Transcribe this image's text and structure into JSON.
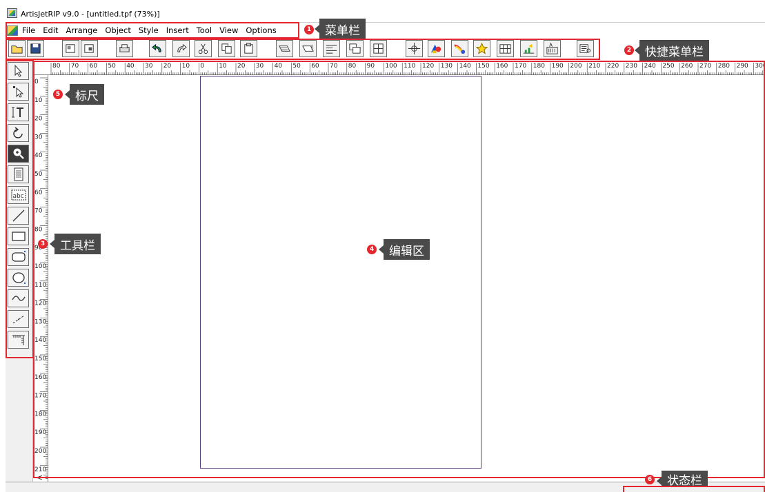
{
  "window": {
    "title": "ArtisJetRIP v9.0 - [untitled.tpf (73%)]"
  },
  "menu": {
    "items": [
      "File",
      "Edit",
      "Arrange",
      "Object",
      "Style",
      "Insert",
      "Tool",
      "View",
      "Options"
    ]
  },
  "toolbar": {
    "buttons": [
      "open-icon",
      "save-icon",
      "import-icon",
      "export-icon",
      "print-icon",
      "undo-icon",
      "redo-icon",
      "cut-icon",
      "copy-icon",
      "paste-icon",
      "bring-front-icon",
      "send-back-icon",
      "flip-icon",
      "group-icon",
      "align-icon",
      "center-icon",
      "color-icon",
      "gradient-icon",
      "star-icon",
      "map-icon",
      "chart-icon",
      "text-fit-icon",
      "preview-icon"
    ]
  },
  "ruler": {
    "horizontal_labels": [
      "80",
      "70",
      "60",
      "50",
      "40",
      "30",
      "20",
      "10",
      "0",
      "10",
      "20",
      "30",
      "40",
      "50",
      "60",
      "70",
      "80",
      "90",
      "100",
      "110",
      "120",
      "130",
      "140",
      "150",
      "160",
      "170",
      "180",
      "190",
      "200",
      "210",
      "220",
      "230",
      "240",
      "250",
      "260",
      "270",
      "280",
      "290",
      "300"
    ],
    "vertical_labels": [
      "0",
      "10",
      "20",
      "30",
      "40",
      "50",
      "60",
      "70",
      "80",
      "90",
      "100",
      "110",
      "120",
      "130",
      "140",
      "150",
      "160",
      "170",
      "180",
      "190",
      "200",
      "210"
    ]
  },
  "tools": [
    "select-arrow-icon",
    "node-select-icon",
    "text-tool-icon",
    "rotate-icon",
    "zoom-icon",
    "page-icon",
    "text-frame-icon",
    "line-icon",
    "rectangle-icon",
    "rounded-rect-icon",
    "ellipse-icon",
    "curve-icon",
    "dashed-line-icon",
    "dimension-icon"
  ],
  "annotations": {
    "menu_bar": {
      "num": "1",
      "label": "菜单栏"
    },
    "quick_menu_bar": {
      "num": "2",
      "label": "快捷菜单栏"
    },
    "toolbar": {
      "num": "3",
      "label": "工具栏"
    },
    "edit_area": {
      "num": "4",
      "label": "编辑区"
    },
    "ruler": {
      "num": "5",
      "label": "标尺"
    },
    "status_bar": {
      "num": "6",
      "label": "状态栏"
    }
  },
  "scroll_left_glyph": "<",
  "colors": {
    "highlight": "#e5262d",
    "annotation_bg": "#4a4a4a",
    "page_border": "#5b3c7a"
  }
}
